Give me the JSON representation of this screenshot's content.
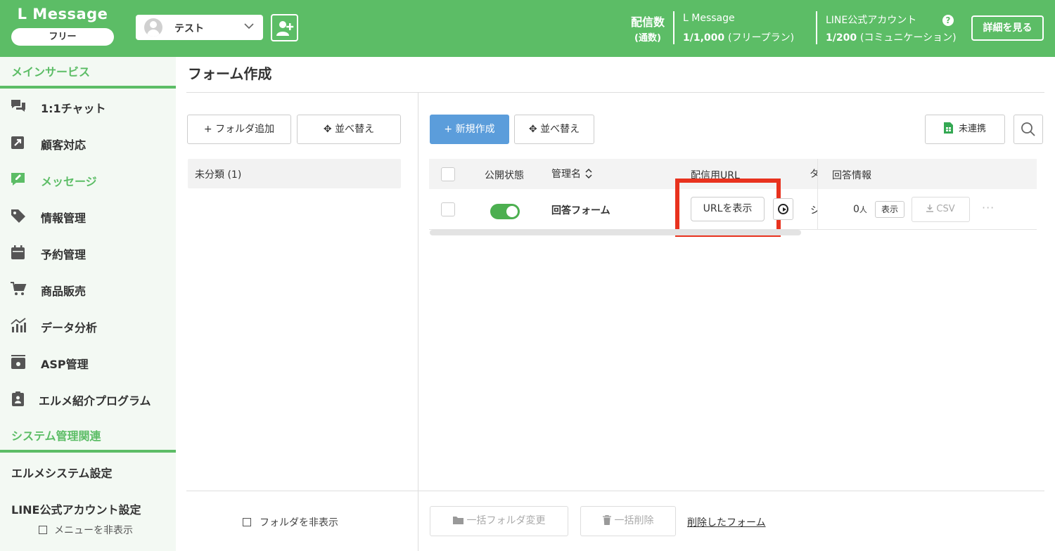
{
  "header": {
    "logo": "L Message",
    "plan_badge": "フリー",
    "account_name": "テスト",
    "stats_label": "配信数",
    "stats_sublabel": "(通数)",
    "lmessage_name": "L Message",
    "lmessage_count": "1/1,000",
    "lmessage_plan": "(フリープラン)",
    "line_name": "LINE公式アカウント",
    "line_count": "1/200",
    "line_plan": "(コミュニケーション)",
    "help_icon": "?",
    "detail_button": "詳細を見る"
  },
  "sidebar": {
    "section_main": "メインサービス",
    "items": [
      {
        "label": "1:1チャット",
        "icon": "chat-icon"
      },
      {
        "label": "顧客対応",
        "icon": "arrow-icon"
      },
      {
        "label": "メッセージ",
        "icon": "message-edit-icon"
      },
      {
        "label": "情報管理",
        "icon": "tag-icon"
      },
      {
        "label": "予約管理",
        "icon": "calendar-icon"
      },
      {
        "label": "商品販売",
        "icon": "cart-icon"
      },
      {
        "label": "データ分析",
        "icon": "chart-icon"
      },
      {
        "label": "ASP管理",
        "icon": "asp-icon"
      },
      {
        "label": "エルメ紹介プログラム",
        "icon": "clipboard-icon"
      }
    ],
    "active_item": "メッセージ",
    "section_system": "システム管理関連",
    "system_settings": "エルメシステム設定",
    "line_settings": "LINE公式アカウント設定",
    "hide_menu": "メニューを非表示"
  },
  "main": {
    "title": "フォーム作成",
    "add_folder_button": "+ フォルダ追加",
    "sort_button": "並べ替え",
    "folders": [
      "未分類 (1)"
    ],
    "new_button": "+ 新規作成",
    "sort_button_right": "並べ替え",
    "sheet_link_button": "未連携",
    "table": {
      "headers": {
        "status": "公開状態",
        "name": "管理名",
        "url": "配信用URL",
        "clipped": "タ",
        "answers": "回答情報"
      },
      "rows": [
        {
          "published": true,
          "name": "回答フォーム",
          "url_button": "URLを表示",
          "clipped": "シ",
          "count": "0",
          "count_unit": "人",
          "show_button": "表示",
          "csv_button": "CSV",
          "more": "···"
        }
      ]
    },
    "footer": {
      "hide_folders": "フォルダを非表示",
      "bulk_folder": "一括フォルダ変更",
      "bulk_delete": "一括削除",
      "deleted_forms": "削除したフォーム"
    }
  },
  "colors": {
    "brand_green": "#5cbd66",
    "primary_blue": "#5b9ddb",
    "highlight_red": "#e8321e",
    "toggle_green": "#4caf50"
  }
}
